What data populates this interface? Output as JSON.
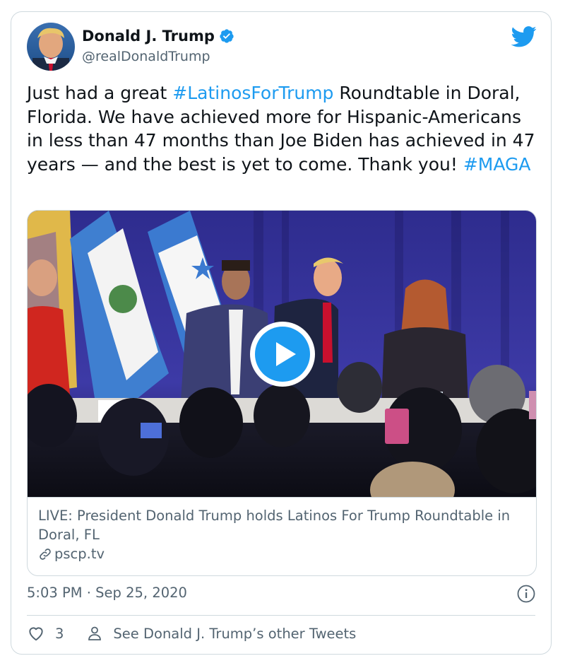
{
  "author": {
    "display_name": "Donald J. Trump",
    "handle": "@realDonaldTrump",
    "verified": true
  },
  "tweet": {
    "text_parts": [
      "Just had a great ",
      "#LatinosForTrump",
      " Roundtable in Doral, Florida. We have achieved more for Hispanic-Americans in less than 47 months than Joe Biden has achieved in 47 years — and the best is yet to come. Thank you! ",
      "#MAGA"
    ]
  },
  "media_card": {
    "title": "LIVE: President Donald Trump holds Latinos For Trump Roundtable in Doral, FL",
    "domain": "pscp.tv"
  },
  "meta": {
    "timestamp": "5:03 PM · Sep 25, 2020",
    "like_count": "3",
    "other_tweets_label": "See Donald J. Trump’s other Tweets"
  },
  "colors": {
    "accent": "#1d9bf0",
    "secondary_text": "#536471",
    "border": "#cfd9de"
  },
  "icons": [
    "verified-badge-icon",
    "twitter-bird-icon",
    "play-icon",
    "link-icon",
    "info-icon",
    "heart-icon",
    "person-icon"
  ]
}
